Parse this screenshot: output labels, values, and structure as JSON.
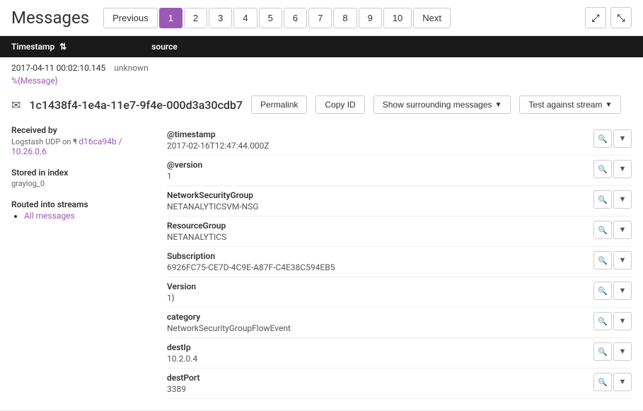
{
  "page": {
    "title": "Messages"
  },
  "pagination": {
    "previous_label": "Previous",
    "next_label": "Next",
    "pages": [
      "1",
      "2",
      "3",
      "4",
      "5",
      "6",
      "7",
      "8",
      "9",
      "10"
    ],
    "active_page": "1"
  },
  "table": {
    "col_timestamp": "Timestamp",
    "col_source": "source"
  },
  "message": {
    "timestamp": "2017-04-11 00:02:10.145",
    "source": "unknown",
    "tag": "%{Message}",
    "id": "1c1438f4-1e4a-11e7-9f4e-000d3a30cdb7",
    "permalink_label": "Permalink",
    "copy_id_label": "Copy ID",
    "surrounding_label": "Show surrounding messages",
    "test_stream_label": "Test against stream"
  },
  "left_panel": {
    "received_by_label": "Received by",
    "received_by_value": "Logstash UDP on",
    "node_link": "d16ca94b / 10.26.0.6",
    "stored_label": "Stored in index",
    "stored_value": "graylog_0",
    "routed_label": "Routed into streams",
    "stream_link": "All messages"
  },
  "fields": [
    {
      "name": "@timestamp",
      "value": "2017-02-16T12:47:44.000Z"
    },
    {
      "name": "@version",
      "value": "1"
    },
    {
      "name": "NetworkSecurityGroup",
      "value": "NETANALYTICSVM-NSG"
    },
    {
      "name": "ResourceGroup",
      "value": "NETANALYTICS"
    },
    {
      "name": "Subscription",
      "value": "6926FC75-CE7D-4C9E-A87F-C4E38C594EB5"
    },
    {
      "name": "Version",
      "value": "1}"
    },
    {
      "name": "category",
      "value": "NetworkSecurityGroupFlowEvent"
    },
    {
      "name": "destIp",
      "value": "10.2.0.4"
    },
    {
      "name": "destPort",
      "value": "3389"
    }
  ]
}
